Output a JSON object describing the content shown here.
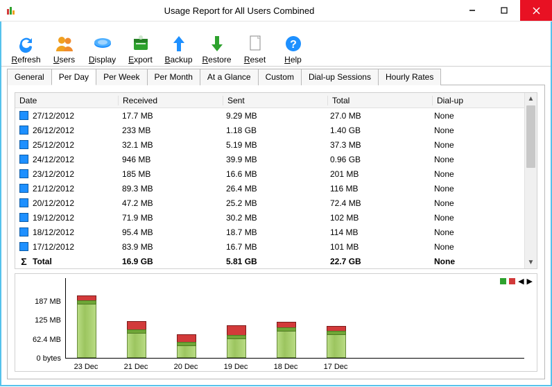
{
  "window": {
    "title": "Usage Report for All Users Combined"
  },
  "toolbar": [
    {
      "id": "refresh",
      "label": "Refresh",
      "icon": "refresh-icon",
      "color": "#1e90ff"
    },
    {
      "id": "users",
      "label": "Users",
      "icon": "users-icon",
      "color": "#f08c2e"
    },
    {
      "id": "display",
      "label": "Display",
      "icon": "display-icon",
      "color": "#1e90ff"
    },
    {
      "id": "export",
      "label": "Export",
      "icon": "export-icon",
      "color": "#2ea22e"
    },
    {
      "id": "backup",
      "label": "Backup",
      "icon": "backup-icon",
      "color": "#1e90ff"
    },
    {
      "id": "restore",
      "label": "Restore",
      "icon": "restore-icon",
      "color": "#2ea22e"
    },
    {
      "id": "reset",
      "label": "Reset",
      "icon": "reset-icon",
      "color": "#444"
    },
    {
      "id": "help",
      "label": "Help",
      "icon": "help-icon",
      "color": "#1e90ff"
    }
  ],
  "tabs": [
    {
      "id": "general",
      "label": "General"
    },
    {
      "id": "perday",
      "label": "Per Day",
      "active": true
    },
    {
      "id": "perweek",
      "label": "Per Week"
    },
    {
      "id": "permonth",
      "label": "Per Month"
    },
    {
      "id": "ataglance",
      "label": "At a Glance"
    },
    {
      "id": "custom",
      "label": "Custom"
    },
    {
      "id": "dialup",
      "label": "Dial-up Sessions"
    },
    {
      "id": "hourly",
      "label": "Hourly Rates"
    }
  ],
  "table": {
    "headers": {
      "date": "Date",
      "received": "Received",
      "sent": "Sent",
      "total": "Total",
      "dialup": "Dial-up"
    },
    "rows": [
      {
        "date": "27/12/2012",
        "received": "17.7 MB",
        "sent": "9.29 MB",
        "total": "27.0 MB",
        "dialup": "None"
      },
      {
        "date": "26/12/2012",
        "received": "233 MB",
        "sent": "1.18 GB",
        "total": "1.40 GB",
        "dialup": "None"
      },
      {
        "date": "25/12/2012",
        "received": "32.1 MB",
        "sent": "5.19 MB",
        "total": "37.3 MB",
        "dialup": "None"
      },
      {
        "date": "24/12/2012",
        "received": "946 MB",
        "sent": "39.9 MB",
        "total": "0.96 GB",
        "dialup": "None"
      },
      {
        "date": "23/12/2012",
        "received": "185 MB",
        "sent": "16.6 MB",
        "total": "201 MB",
        "dialup": "None"
      },
      {
        "date": "21/12/2012",
        "received": "89.3 MB",
        "sent": "26.4 MB",
        "total": "116 MB",
        "dialup": "None"
      },
      {
        "date": "20/12/2012",
        "received": "47.2 MB",
        "sent": "25.2 MB",
        "total": "72.4 MB",
        "dialup": "None"
      },
      {
        "date": "19/12/2012",
        "received": "71.9 MB",
        "sent": "30.2 MB",
        "total": "102 MB",
        "dialup": "None"
      },
      {
        "date": "18/12/2012",
        "received": "95.4 MB",
        "sent": "18.7 MB",
        "total": "114 MB",
        "dialup": "None"
      },
      {
        "date": "17/12/2012",
        "received": "83.9 MB",
        "sent": "16.7 MB",
        "total": "101 MB",
        "dialup": "None"
      }
    ],
    "total": {
      "label": "Total",
      "received": "16.9 GB",
      "sent": "5.81 GB",
      "total": "22.7 GB",
      "dialup": "None"
    }
  },
  "chart_data": {
    "type": "bar",
    "categories": [
      "23 Dec",
      "21 Dec",
      "20 Dec",
      "19 Dec",
      "18 Dec",
      "17 Dec"
    ],
    "series": [
      {
        "name": "Received",
        "color": "#a9cf6f",
        "values": [
          185,
          89.3,
          47.2,
          71.9,
          95.4,
          83.9
        ]
      },
      {
        "name": "Sent",
        "color": "#d23a3a",
        "values": [
          16.6,
          26.4,
          25.2,
          30.2,
          18.7,
          16.7
        ]
      }
    ],
    "y_ticks": [
      {
        "label": "187 MB",
        "value": 187
      },
      {
        "label": "125 MB",
        "value": 125
      },
      {
        "label": "62.4 MB",
        "value": 62.4
      },
      {
        "label": "0 bytes",
        "value": 0
      }
    ],
    "ymax": 201,
    "unit": "MB"
  }
}
